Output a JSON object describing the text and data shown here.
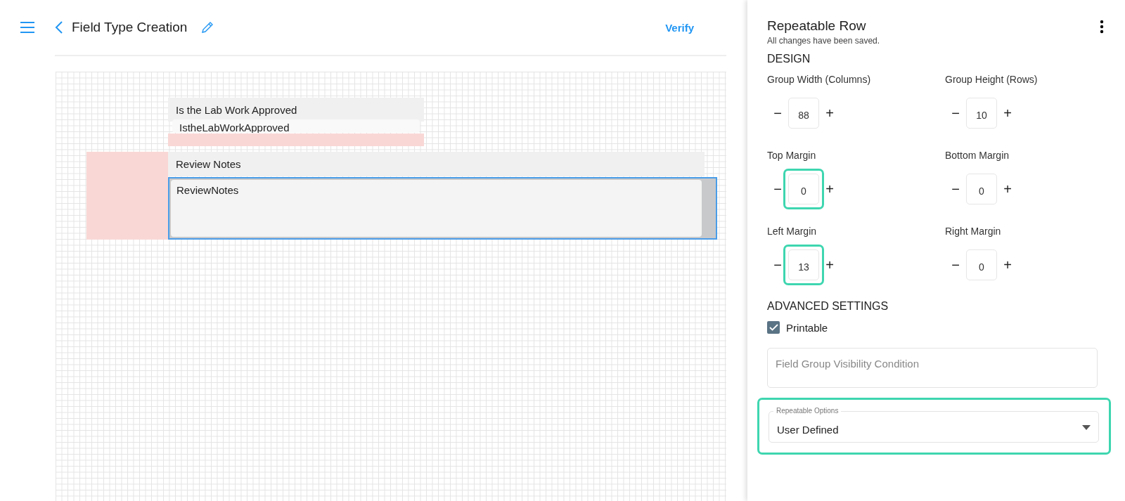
{
  "header": {
    "title": "Field Type Creation",
    "action": "Verify"
  },
  "canvas": {
    "fields": [
      {
        "label": "Is the Lab Work Approved",
        "value": "IstheLabWorkApproved",
        "kind": "short",
        "selected": false
      },
      {
        "label": "Review Notes",
        "value": "ReviewNotes",
        "kind": "notes",
        "selected": true
      }
    ]
  },
  "panel": {
    "title": "Repeatable Row",
    "status": "All changes have been saved.",
    "design_heading": "DESIGN",
    "steppers": [
      {
        "label": "Group Width (Columns)",
        "value": "88",
        "minus": "−",
        "plus": "+",
        "highlighted": false
      },
      {
        "label": "Group Height (Rows)",
        "value": "10",
        "minus": "−",
        "plus": "+",
        "highlighted": false
      },
      {
        "label": "Top Margin",
        "value": "0",
        "minus": "−",
        "plus": "+",
        "highlighted": true
      },
      {
        "label": "Bottom Margin",
        "value": "0",
        "minus": "−",
        "plus": "+",
        "highlighted": false
      },
      {
        "label": "Left Margin",
        "value": "13",
        "minus": "−",
        "plus": "+",
        "highlighted": true
      },
      {
        "label": "Right Margin",
        "value": "0",
        "minus": "−",
        "plus": "+",
        "highlighted": false
      }
    ],
    "advanced_heading": "ADVANCED SETTINGS",
    "printable": {
      "label": "Printable",
      "checked": true
    },
    "visibility_condition": {
      "placeholder": "Field Group Visibility Condition"
    },
    "repeatable_options": {
      "label": "Repeatable Options",
      "value": "User Defined",
      "highlighted": true
    }
  }
}
